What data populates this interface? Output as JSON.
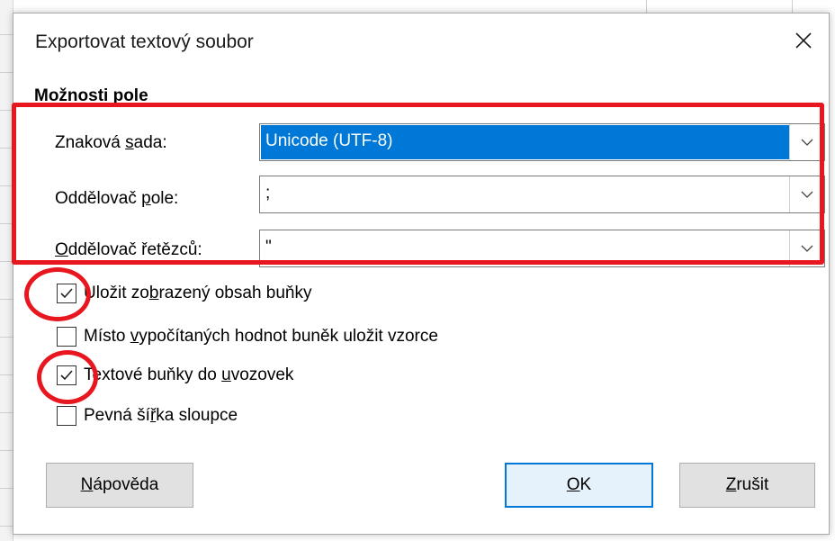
{
  "dialog": {
    "title": "Exportovat textový soubor",
    "close_icon": "close-icon"
  },
  "section": {
    "title": "Možnosti pole"
  },
  "fields": {
    "charset": {
      "label_pre": "Znaková ",
      "label_key": "s",
      "label_post": "ada:",
      "value": "Unicode (UTF-8)"
    },
    "field_sep": {
      "label_pre": "Oddělovač ",
      "label_key": "p",
      "label_post": "ole:",
      "value": ";"
    },
    "string_sep": {
      "label_pre": "",
      "label_key": "O",
      "label_post": "ddělovač řetězců:",
      "value": "\""
    }
  },
  "checkboxes": [
    {
      "label_pre": "Uložit zo",
      "label_key": "b",
      "label_post": "razený obsah buňky",
      "checked": true
    },
    {
      "label_pre": "Místo ",
      "label_key": "v",
      "label_post": "ypočítaných hodnot buněk uložit vzorce",
      "checked": false
    },
    {
      "label_pre": "Textové buňky do ",
      "label_key": "u",
      "label_post": "vozovek",
      "checked": true
    },
    {
      "label_pre": "Pevná ší",
      "label_key": "ř",
      "label_post": "ka sloupce",
      "checked": false
    }
  ],
  "buttons": {
    "help": {
      "key": "N",
      "rest": "ápověda"
    },
    "ok": {
      "key": "O",
      "rest": "K"
    },
    "cancel": {
      "key": "Z",
      "rest": "rušit"
    }
  },
  "colors": {
    "annotation": "#e8161e",
    "selection": "#0078d7"
  }
}
